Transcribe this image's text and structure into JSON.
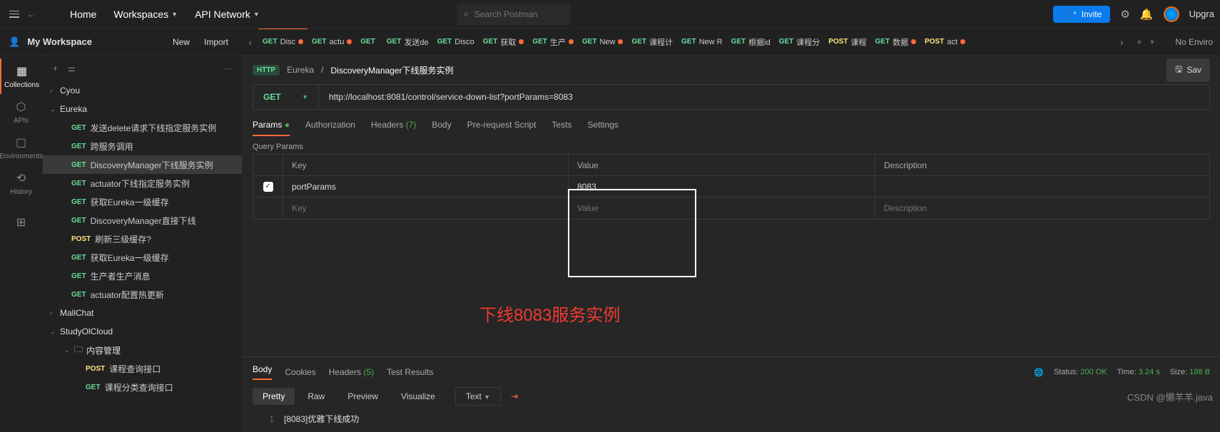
{
  "topnav": {
    "home": "Home",
    "workspaces": "Workspaces",
    "api": "API Network"
  },
  "search": {
    "placeholder": "Search Postman"
  },
  "actions": {
    "invite": "Invite",
    "upgrade": "Upgra"
  },
  "workspace": {
    "name": "My Workspace",
    "new": "New",
    "import": "Import"
  },
  "tabs": [
    {
      "method": "GET",
      "title": "Disc",
      "mod": true,
      "active": true
    },
    {
      "method": "GET",
      "title": "actu",
      "mod": true
    },
    {
      "method": "GET",
      "title": ""
    },
    {
      "method": "GET",
      "title": "发送de"
    },
    {
      "method": "GET",
      "title": "Disco"
    },
    {
      "method": "GET",
      "title": "获取",
      "mod": true
    },
    {
      "method": "GET",
      "title": "生产",
      "mod": true
    },
    {
      "method": "GET",
      "title": "New",
      "mod": true
    },
    {
      "method": "GET",
      "title": "课程计"
    },
    {
      "method": "GET",
      "title": "New R"
    },
    {
      "method": "GET",
      "title": "根据id"
    },
    {
      "method": "GET",
      "title": "课程分"
    },
    {
      "method": "POST",
      "title": "课程"
    },
    {
      "method": "GET",
      "title": "数据",
      "mod": true
    },
    {
      "method": "POST",
      "title": "act",
      "mod": true
    }
  ],
  "noenv": "No Enviro",
  "leftnav": [
    {
      "label": "Collections",
      "active": true
    },
    {
      "label": "APIs"
    },
    {
      "label": "Environments"
    },
    {
      "label": "History"
    }
  ],
  "tree": {
    "folders": [
      {
        "name": "Cyou",
        "open": false,
        "indent": 0
      },
      {
        "name": "Eureka",
        "open": true,
        "indent": 0,
        "items": [
          {
            "method": "GET",
            "name": "发送delete请求下线指定服务实例"
          },
          {
            "method": "GET",
            "name": "跨服务调用"
          },
          {
            "method": "GET",
            "name": "DiscoveryManager下线服务实例",
            "selected": true
          },
          {
            "method": "GET",
            "name": "actuator下线指定服务实例"
          },
          {
            "method": "GET",
            "name": "获取Eureka一级缓存"
          },
          {
            "method": "GET",
            "name": "DiscoveryManager直接下线"
          },
          {
            "method": "POST",
            "name": "刷新三级缓存?"
          },
          {
            "method": "GET",
            "name": "获取Eureka一级缓存"
          },
          {
            "method": "GET",
            "name": "生产者生产消息"
          },
          {
            "method": "GET",
            "name": "actuator配置热更新"
          }
        ]
      },
      {
        "name": "MallChat",
        "open": false,
        "indent": 0
      },
      {
        "name": "StudyOlCloud",
        "open": true,
        "indent": 0
      },
      {
        "name": "内容管理",
        "open": true,
        "indent": 1,
        "icon": "folder",
        "items": [
          {
            "method": "POST",
            "name": "课程查询接口"
          },
          {
            "method": "GET",
            "name": "课程分类查询接口"
          }
        ]
      }
    ]
  },
  "breadcrumb": {
    "badge": "HTTP",
    "parent": "Eureka",
    "sep": "/",
    "title": "DiscoveryManager下线服务实例",
    "save": "Sav"
  },
  "request": {
    "method": "GET",
    "url": "http://localhost:8081/control/service-down-list?portParams=8083"
  },
  "reqtabs": [
    {
      "label": "Params",
      "dot": true,
      "active": true
    },
    {
      "label": "Authorization"
    },
    {
      "label": "Headers",
      "count": "(7)"
    },
    {
      "label": "Body"
    },
    {
      "label": "Pre-request Script"
    },
    {
      "label": "Tests"
    },
    {
      "label": "Settings"
    }
  ],
  "query": {
    "title": "Query Params",
    "headers": {
      "key": "Key",
      "value": "Value",
      "desc": "Description"
    },
    "rows": [
      {
        "checked": true,
        "key": "portParams",
        "value": "8083",
        "desc": ""
      }
    ],
    "placeholder": {
      "key": "Key",
      "value": "Value",
      "desc": "Description"
    }
  },
  "annotation": "下线8083服务实例",
  "response": {
    "tabs": [
      {
        "label": "Body",
        "active": true
      },
      {
        "label": "Cookies"
      },
      {
        "label": "Headers",
        "count": "(5)"
      },
      {
        "label": "Test Results"
      }
    ],
    "status": {
      "label": "Status:",
      "value": "200 OK"
    },
    "time": {
      "label": "Time:",
      "value": "3.24 s"
    },
    "size": {
      "label": "Size:",
      "value": "188 B"
    },
    "modes": [
      {
        "label": "Pretty",
        "active": true
      },
      {
        "label": "Raw"
      },
      {
        "label": "Preview"
      },
      {
        "label": "Visualize"
      }
    ],
    "lang": "Text",
    "body": {
      "line": "1",
      "text": "[8083]优雅下线成功"
    }
  },
  "watermark": "CSDN @懒羊羊.java"
}
